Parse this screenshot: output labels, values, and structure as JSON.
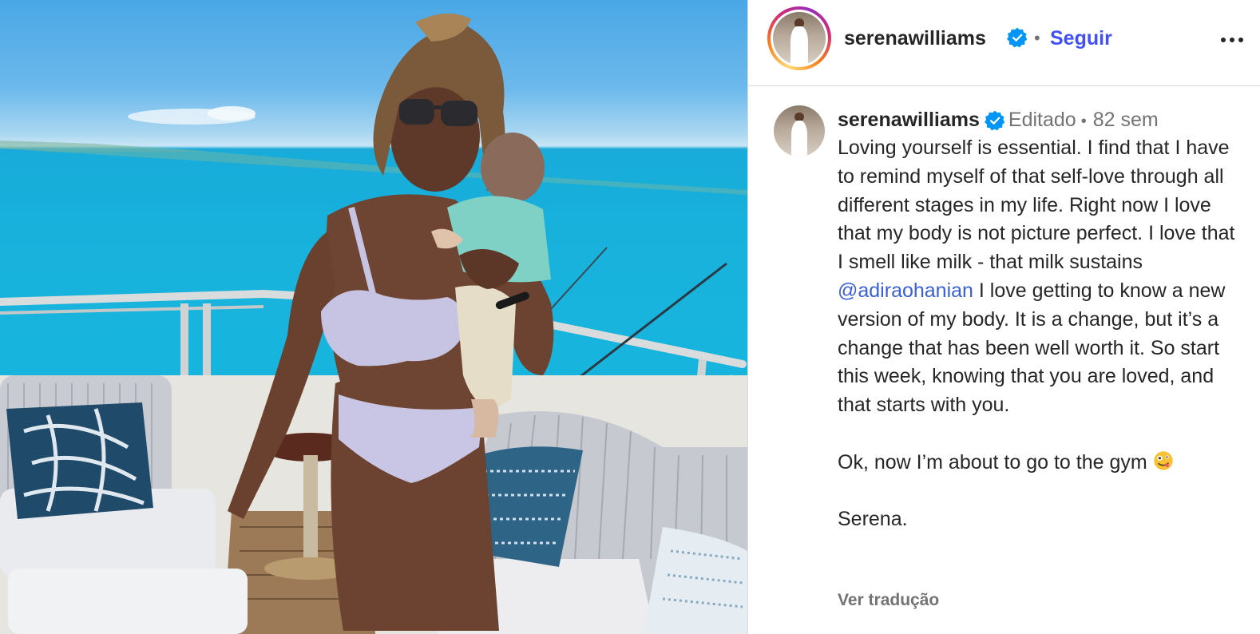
{
  "header": {
    "username": "serenawilliams",
    "separator": "•",
    "follow_label": "Seguir",
    "more_icon": "more-horizontal-icon"
  },
  "caption": {
    "username": "serenawilliams",
    "edited_label": "Editado",
    "separator": "•",
    "time_ago": "82 sem",
    "text_part1": "Loving yourself is essential. I find that I have to remind myself of that self-love through all different stages in my life. Right now I love that my body is not picture perfect. I love that I smell like milk - that milk sustains",
    "mention": "@adiraohanian",
    "text_part2": "I love getting to know a new version of my body. It is a change, but it’s a change that has been well worth it. So start this week, knowing that you are loved, and that starts with you.",
    "line_gym": "Ok, now I’m about to go to the gym",
    "signature": "Serena.",
    "translate_label": "Ver tradução"
  },
  "colors": {
    "link_blue": "#4150f7",
    "mention_blue": "#3a5fd6",
    "verified_blue": "#0095f6",
    "muted_gray": "#737373"
  },
  "icons": {
    "verified": "verified-badge-icon",
    "emoji": "zany-face-emoji"
  }
}
